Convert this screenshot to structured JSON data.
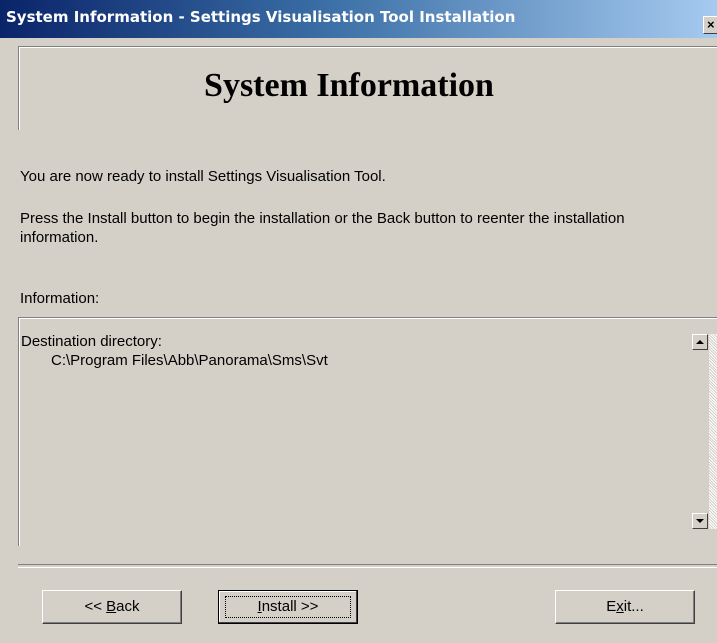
{
  "window": {
    "title": "System Information - Settings Visualisation Tool Installation",
    "close_glyph": "×"
  },
  "banner": {
    "title": "System Information"
  },
  "body": {
    "ready_text": "You are now ready to install Settings Visualisation Tool.",
    "instructions_text": "Press the Install button to begin the installation or the Back button to reenter the installation information.",
    "information_label": "Information:"
  },
  "info_box": {
    "destination_label": "Destination directory:",
    "destination_value": "C:\\Program Files\\Abb\\Panorama\\Sms\\Svt"
  },
  "buttons": {
    "back": {
      "prefix": "<< ",
      "accel": "B",
      "rest": "ack"
    },
    "install": {
      "accel": "I",
      "rest": "nstall >>"
    },
    "exit": {
      "pre": "E",
      "accel": "x",
      "rest": "it..."
    }
  }
}
